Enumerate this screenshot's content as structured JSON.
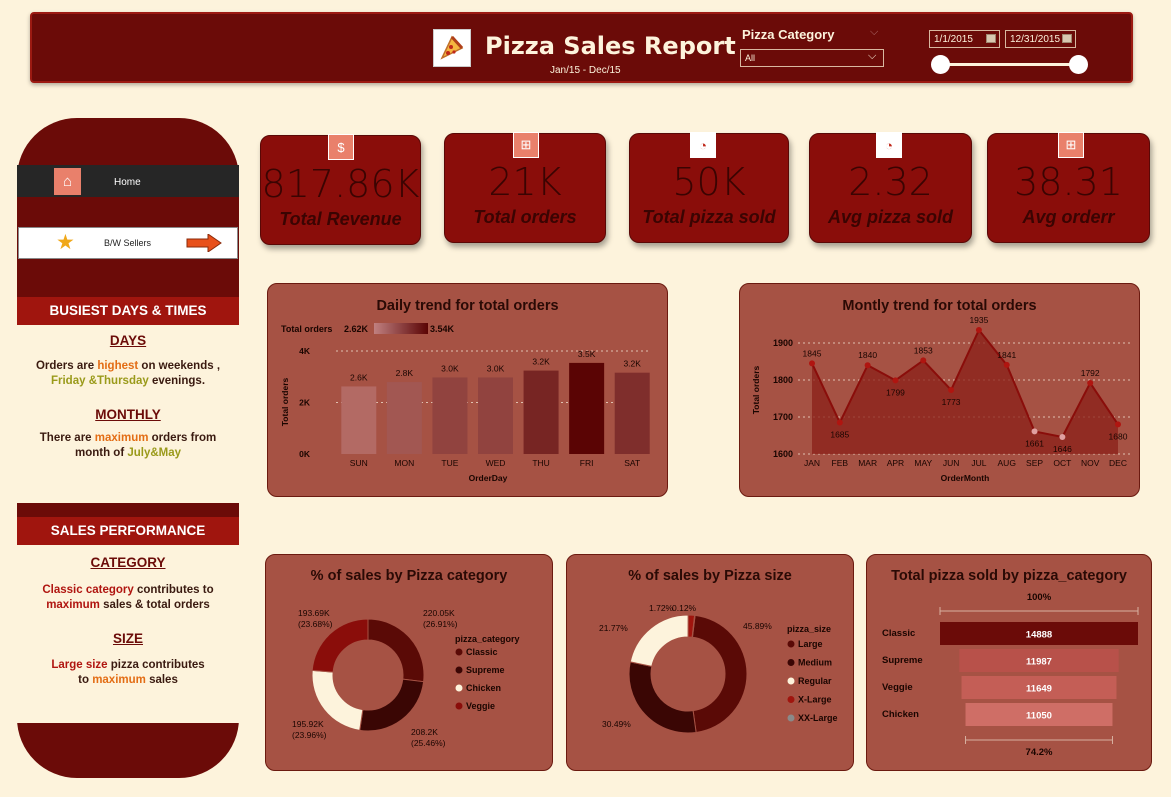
{
  "header": {
    "title": "Pizza Sales Report",
    "subtitle": "Jan/15 - Dec/15",
    "category_label": "Pizza Category",
    "category_value": "All",
    "date_start": "1/1/2015",
    "date_end": "12/31/2015"
  },
  "sidebar": {
    "home_label": "Home",
    "sellers_label": "B/W Sellers",
    "busiest": {
      "header": "BUSIEST DAYS & TIMES",
      "days_title": "DAYS",
      "days_t1": "Orders are ",
      "days_hl1": "highest",
      "days_t2": " on weekends ,",
      "days_hl2": "Friday &Thursday",
      "days_t3": " evenings.",
      "monthly_title": "MONTHLY",
      "monthly_t1": "There are ",
      "monthly_hl1": "maximum",
      "monthly_t2": " orders from",
      "monthly_t3": "month of ",
      "monthly_hl2": "July&May"
    },
    "performance": {
      "header": "SALES PERFORMANCE",
      "category_title": "CATEGORY",
      "cat_hl1": "Classic category",
      "cat_t1": " contributes to",
      "cat_hl2": "maximum",
      "cat_t2": " sales & total orders",
      "size_title": "SIZE",
      "size_hl1": "Large size",
      "size_t1": " pizza contributes",
      "size_t2": "to ",
      "size_hl2": "maximum",
      "size_t3": " sales"
    }
  },
  "kpis": [
    {
      "value": "817.86K",
      "label": "Total Revenue",
      "icon": "money-bag-icon"
    },
    {
      "value": "21K",
      "label": "Total orders",
      "icon": "cart-icon"
    },
    {
      "value": "50K",
      "label": "Total pizza sold",
      "icon": "pizza-icon"
    },
    {
      "value": "2.32",
      "label": "Avg pizza sold",
      "icon": "pizza-icon"
    },
    {
      "value": "38.31",
      "label": "Avg orderr",
      "icon": "cart-icon"
    }
  ],
  "colors": {
    "dark_red": "#6b0b08",
    "panel": "#a65244",
    "cream": "#fdf3dc"
  },
  "chart_data": [
    {
      "type": "bar",
      "title": "Daily trend for total orders",
      "legend_title": "Total orders",
      "legend_min": "2.62K",
      "legend_max": "3.54K",
      "xlabel": "OrderDay",
      "ylabel": "Total orders",
      "categories": [
        "SUN",
        "MON",
        "TUE",
        "WED",
        "THU",
        "FRI",
        "SAT"
      ],
      "values": [
        2624,
        2794,
        2973,
        2973,
        3239,
        3538,
        3158
      ],
      "value_labels": [
        "2.6K",
        "2.8K",
        "3.0K",
        "3.0K",
        "3.2K",
        "3.5K",
        "3.2K"
      ],
      "ylim": [
        0,
        4000
      ],
      "yticks": [
        "0K",
        "2K",
        "4K"
      ]
    },
    {
      "type": "area",
      "title": "Montly trend for total orders",
      "xlabel": "OrderMonth",
      "ylabel": "Total orders",
      "categories": [
        "JAN",
        "FEB",
        "MAR",
        "APR",
        "MAY",
        "JUN",
        "JUL",
        "AUG",
        "SEP",
        "OCT",
        "NOV",
        "DEC"
      ],
      "values": [
        1845,
        1685,
        1840,
        1799,
        1853,
        1773,
        1935,
        1841,
        1661,
        1646,
        1792,
        1680
      ],
      "ylim": [
        1600,
        1900
      ],
      "yticks": [
        "1600",
        "1700",
        "1800",
        "1900"
      ]
    },
    {
      "type": "pie",
      "title": "% of sales by Pizza category",
      "legend_title": "pizza_category",
      "labels": [
        "Classic",
        "Supreme",
        "Chicken",
        "Veggie"
      ],
      "values": [
        220.05,
        208.2,
        195.92,
        193.69
      ],
      "value_labels": [
        "220.05K",
        "208.2K",
        "195.92K",
        "193.69K"
      ],
      "pct_labels": [
        "(26.91%)",
        "(25.46%)",
        "(23.96%)",
        "(23.68%)"
      ],
      "colors": [
        "#5a0a06",
        "#3a0604",
        "#fdf3dc",
        "#8a0d0a"
      ]
    },
    {
      "type": "pie",
      "title": "% of sales by Pizza size",
      "legend_title": "pizza_size",
      "labels": [
        "Large",
        "Medium",
        "Regular",
        "X-Large",
        "XX-Large"
      ],
      "values": [
        45.89,
        30.49,
        21.77,
        1.72,
        0.12
      ],
      "pct_labels": [
        "45.89%",
        "30.49%",
        "21.77%",
        "1.72%",
        "0.12%"
      ],
      "colors": [
        "#5a0a06",
        "#3a0604",
        "#fdf3dc",
        "#a0150e",
        "#8a8a8a"
      ]
    },
    {
      "type": "bar",
      "title": "Total pizza sold by pizza_category",
      "categories": [
        "Classic",
        "Supreme",
        "Veggie",
        "Chicken"
      ],
      "values": [
        14888,
        11987,
        11649,
        11050
      ],
      "top_label": "100%",
      "bottom_label": "74.2%"
    }
  ]
}
